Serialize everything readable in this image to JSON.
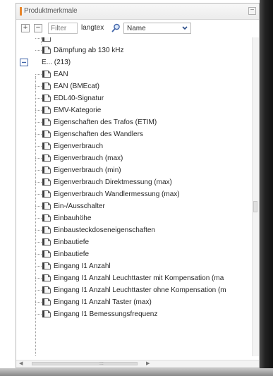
{
  "panel": {
    "title": "Produktmerkmale",
    "collapse_symbol": "−"
  },
  "toolbar": {
    "expand_all_symbol": "+",
    "collapse_all_symbol": "−",
    "filter_placeholder": "Filter",
    "language_value": "langtex",
    "sort_select_value": "Name"
  },
  "tree": {
    "partial_top_label": "Dämpfung ab 130 kHz",
    "group_label": "E... (213)",
    "items": [
      "EAN",
      "EAN (BMEcat)",
      "EDL40-Signatur",
      "EMV-Kategorie",
      "Eigenschaften des Trafos (ETIM)",
      "Eigenschaften des Wandlers",
      "Eigenverbrauch",
      "Eigenverbrauch (max)",
      "Eigenverbrauch (min)",
      "Eigenverbrauch Direktmessung (max)",
      "Eigenverbrauch Wandlermessung (max)",
      "Ein-/Ausschalter",
      "Einbauhöhe",
      "Einbausteckdoseneigenschaften",
      "Einbautiefe",
      "Einbautiefe",
      "Eingang I1 Anzahl",
      "Eingang I1 Anzahl Leuchttaster mit Kompensation (ma",
      "Eingang I1 Anzahl Leuchttaster ohne Kompensation (m",
      "Eingang I1 Anzahl Taster (max)",
      "Eingang I1 Bemessungsfrequenz"
    ]
  },
  "icons": {
    "document": "document-icon",
    "search": "search-icon",
    "expander": "tree-collapse-icon",
    "dropdown": "chevron-down-icon"
  },
  "colors": {
    "title_accent": "#e8852a",
    "expander": "#3f63a8"
  }
}
